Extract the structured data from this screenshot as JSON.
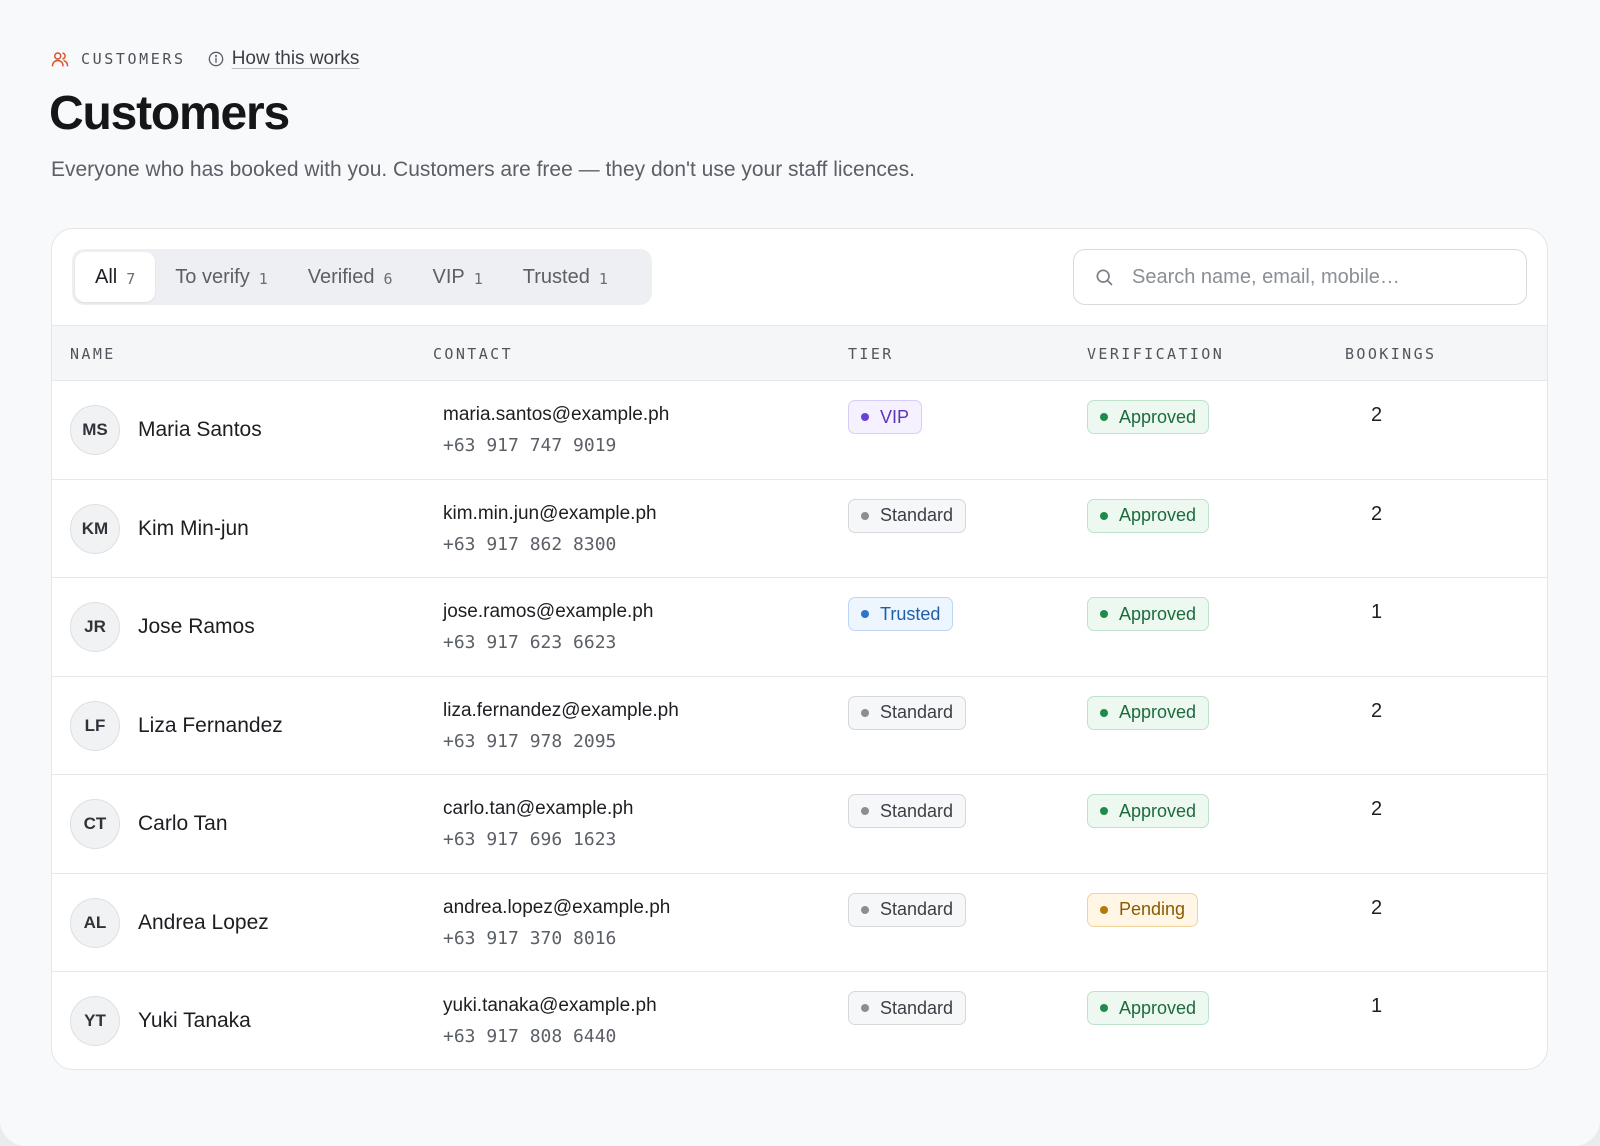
{
  "header": {
    "section_label": "CUSTOMERS",
    "how_link": "How this works",
    "title": "Customers",
    "subtitle": "Everyone who has booked with you. Customers are free — they don't use your staff licences."
  },
  "filters": [
    {
      "label": "All",
      "count": "7",
      "active": true
    },
    {
      "label": "To verify",
      "count": "1",
      "active": false
    },
    {
      "label": "Verified",
      "count": "6",
      "active": false
    },
    {
      "label": "VIP",
      "count": "1",
      "active": false
    },
    {
      "label": "Trusted",
      "count": "1",
      "active": false
    }
  ],
  "search": {
    "placeholder": "Search name, email, mobile…",
    "value": ""
  },
  "columns": {
    "name": "NAME",
    "contact": "CONTACT",
    "tier": "TIER",
    "verification": "VERIFICATION",
    "bookings": "BOOKINGS"
  },
  "badge_styles": {
    "VIP": {
      "bg": "#f5f1ff",
      "border": "#d8cdf6",
      "text": "#5a35b8",
      "dot": "#6c3fd6"
    },
    "Standard": {
      "bg": "#f6f7f8",
      "border": "#d4d7db",
      "text": "#3c4046",
      "dot": "#8a8e95"
    },
    "Trusted": {
      "bg": "#edf5ff",
      "border": "#bcd6f3",
      "text": "#1f5ea8",
      "dot": "#2f74c7"
    },
    "Approved": {
      "bg": "#edf8f1",
      "border": "#bfe2cc",
      "text": "#1d6b3c",
      "dot": "#1f8a4c"
    },
    "Pending": {
      "bg": "#fff6e6",
      "border": "#f1d39a",
      "text": "#8a5a00",
      "dot": "#b7790a"
    }
  },
  "customers": [
    {
      "initials": "MS",
      "name": "Maria Santos",
      "email": "maria.santos@example.ph",
      "phone": "+63 917 747 9019",
      "tier": "VIP",
      "verification": "Approved",
      "bookings": "2"
    },
    {
      "initials": "KM",
      "name": "Kim Min-jun",
      "email": "kim.min.jun@example.ph",
      "phone": "+63 917 862 8300",
      "tier": "Standard",
      "verification": "Approved",
      "bookings": "2"
    },
    {
      "initials": "JR",
      "name": "Jose Ramos",
      "email": "jose.ramos@example.ph",
      "phone": "+63 917 623 6623",
      "tier": "Trusted",
      "verification": "Approved",
      "bookings": "1"
    },
    {
      "initials": "LF",
      "name": "Liza Fernandez",
      "email": "liza.fernandez@example.ph",
      "phone": "+63 917 978 2095",
      "tier": "Standard",
      "verification": "Approved",
      "bookings": "2"
    },
    {
      "initials": "CT",
      "name": "Carlo Tan",
      "email": "carlo.tan@example.ph",
      "phone": "+63 917 696 1623",
      "tier": "Standard",
      "verification": "Approved",
      "bookings": "2"
    },
    {
      "initials": "AL",
      "name": "Andrea Lopez",
      "email": "andrea.lopez@example.ph",
      "phone": "+63 917 370 8016",
      "tier": "Standard",
      "verification": "Pending",
      "bookings": "2"
    },
    {
      "initials": "YT",
      "name": "Yuki Tanaka",
      "email": "yuki.tanaka@example.ph",
      "phone": "+63 917 808 6440",
      "tier": "Standard",
      "verification": "Approved",
      "bookings": "1"
    }
  ],
  "icons": {
    "section": "users-icon",
    "how": "info-icon",
    "search": "search-icon"
  }
}
